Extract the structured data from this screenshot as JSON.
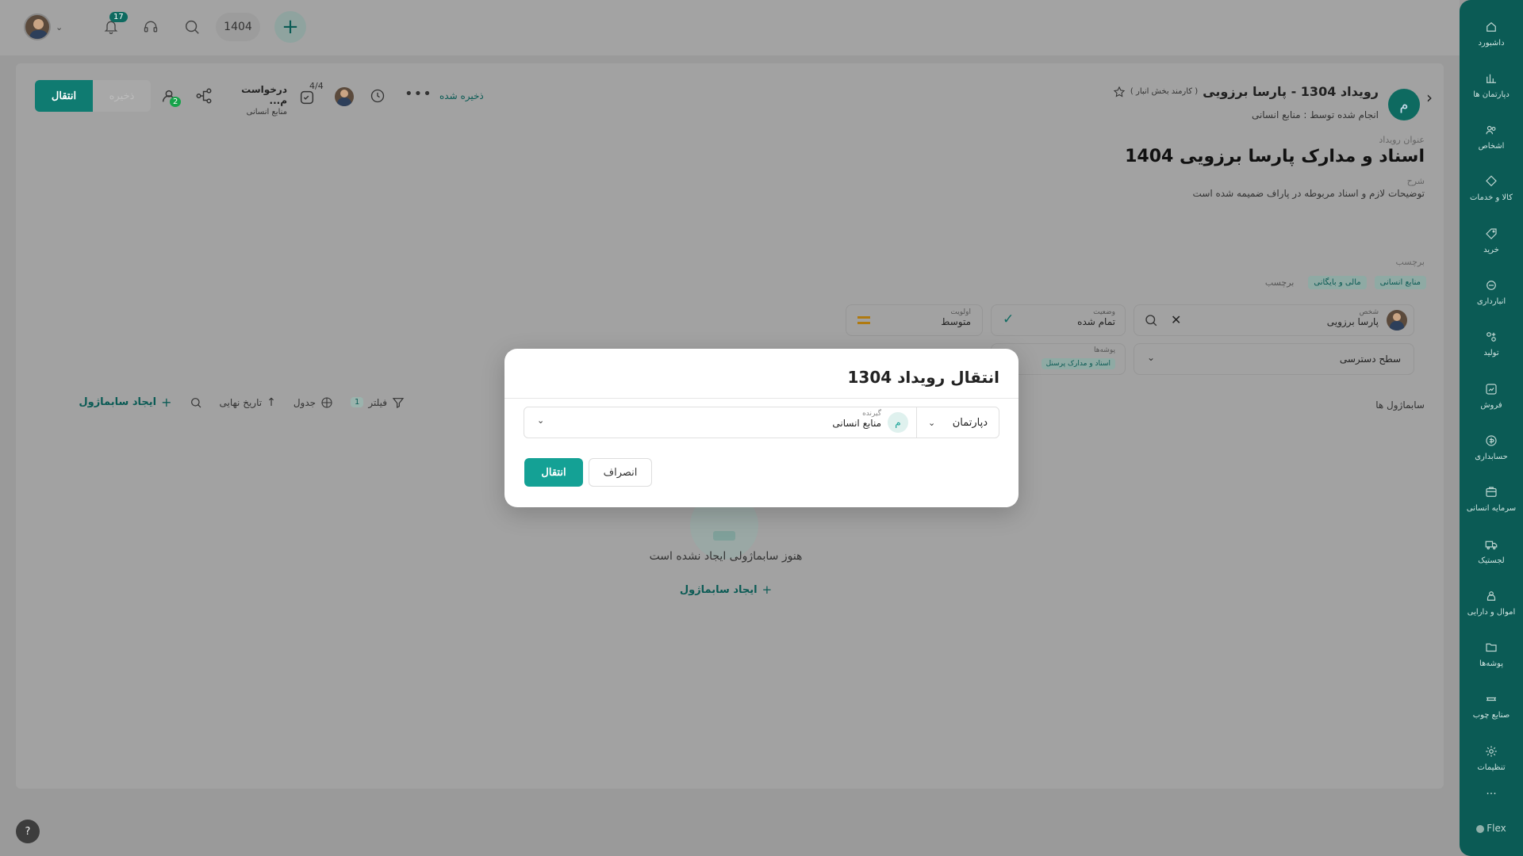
{
  "topbar": {
    "notification_count": "17",
    "year_value": "1404"
  },
  "sidebar": {
    "items": [
      {
        "label": "داشبورد",
        "icon": "home-icon"
      },
      {
        "label": "دپارتمان ها",
        "icon": "chart-icon"
      },
      {
        "label": "اشخاص",
        "icon": "people-icon"
      },
      {
        "label": "کالا و خدمات",
        "icon": "box-icon"
      },
      {
        "label": "خرید",
        "icon": "tag-icon"
      },
      {
        "label": "انبارداری",
        "icon": "warehouse-icon"
      },
      {
        "label": "تولید",
        "icon": "production-icon"
      },
      {
        "label": "فروش",
        "icon": "sales-icon"
      },
      {
        "label": "حسابداری",
        "icon": "accounting-icon"
      },
      {
        "label": "سرمایه انسانی",
        "icon": "hr-icon"
      },
      {
        "label": "لجستیک",
        "icon": "truck-icon"
      },
      {
        "label": "اموال و دارایی",
        "icon": "asset-icon"
      },
      {
        "label": "پوشه‌ها",
        "icon": "folder-icon"
      },
      {
        "label": "صنایع چوب",
        "icon": "wood-icon"
      },
      {
        "label": "تنظیمات",
        "icon": "gear-icon"
      }
    ],
    "more": "...",
    "brand": "Flex"
  },
  "header": {
    "avatar_letter": "م",
    "event_title": "رویداد 1304 - پارسا برزویی",
    "event_subtitle": "( کارمند بخش انبار )",
    "performed_by": "انجام شده توسط : منابع انسانی",
    "saved_label": "ذخیره شده",
    "progress": "4/4",
    "request_title": "درخواست م...",
    "request_sub": "منابع انسانی",
    "watchers_count": "2",
    "save_btn": "ذخیره",
    "transfer_btn": "انتقال"
  },
  "content": {
    "event_title_label": "عنوان رویداد",
    "event_title_value": "اسناد و مدارک پارسا برزویی 1404",
    "desc_label": "شرح",
    "desc_value": "توضیحات لازم و اسناد مربوطه در پاراف ضمیمه شده است",
    "tags_label": "برچسب",
    "tags": [
      "منابع انسانی",
      "مالی و بایگانی"
    ],
    "tags_placeholder": "برچسب",
    "person_label": "شخص",
    "person_value": "پارسا برزویی",
    "status_label": "وضعیت",
    "status_value": "تمام شده",
    "priority_label": "اولویت",
    "priority_value": "متوسط",
    "access_label": "سطح دسترسی",
    "folders_label": "پوشه‌ها",
    "folder_tag": "اسناد و مدارک پرسنل",
    "subprocess_title": "سابماژول ها",
    "filter_label": "فیلتر",
    "filter_count": "1",
    "table_label": "جدول",
    "sort_label": "تاریخ نهایی",
    "create_sub": "ایجاد سابماژول",
    "empty_text": "هنوز سابماژولی ایجاد نشده است",
    "empty_create": "ایجاد سابماژول"
  },
  "modal": {
    "title": "انتقال رویداد 1304",
    "dept_select": "دپارتمان",
    "receiver_label": "گیرنده",
    "receiver_value": "منابع انسانی",
    "receiver_avatar": "م",
    "cancel_btn": "انصراف",
    "submit_btn": "انتقال"
  },
  "help": "?"
}
